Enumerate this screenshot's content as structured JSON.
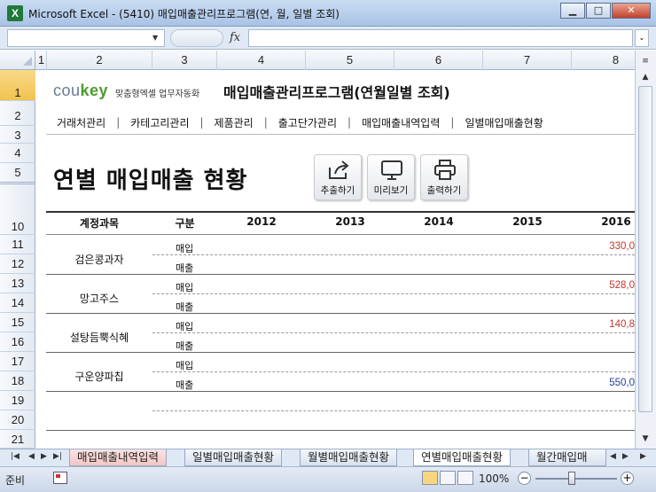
{
  "window": {
    "app_icon": "X",
    "title": "Microsoft Excel - (5410) 매입매출관리프로그램(연, 월, 일별 조회)",
    "minimize": "▁",
    "maximize": "□",
    "close": "✕"
  },
  "formula_bar": {
    "name_box": "",
    "fx": "fx",
    "formula": ""
  },
  "columns": [
    "1",
    "2",
    "3",
    "4",
    "5",
    "6",
    "7",
    "8"
  ],
  "rows": [
    "1",
    "2",
    "3",
    "4",
    "5",
    "10",
    "11",
    "12",
    "13",
    "14",
    "15",
    "16",
    "17",
    "18",
    "19",
    "20",
    "21"
  ],
  "sheet": {
    "logo": "coukey",
    "logo_sub": "맞춤형엑셀 업무자동화",
    "program_title": "매입매출관리프로그램(연월일별 조회)",
    "menu": [
      "거래처관리",
      "카테고리관리",
      "제품관리",
      "출고단가관리",
      "매입매출내역입력",
      "일별매입매출현황"
    ],
    "menu_sep": "|",
    "page_title": "연별 매입매출 현황",
    "buttons": {
      "export": "추출하기",
      "preview": "미리보기",
      "print": "출력하기"
    },
    "table": {
      "headers": [
        "계정과목",
        "구분",
        "2012",
        "2013",
        "2014",
        "2015",
        "2016"
      ],
      "accounts": [
        {
          "name": "검은콩과자",
          "purchase_label": "매입",
          "sales_label": "매출",
          "purchase_2016": "330,0",
          "sales_2016": ""
        },
        {
          "name": "망고주스",
          "purchase_label": "매입",
          "sales_label": "매출",
          "purchase_2016": "528,0",
          "sales_2016": ""
        },
        {
          "name": "설탕듬뿍식혜",
          "purchase_label": "매입",
          "sales_label": "매출",
          "purchase_2016": "140,8",
          "sales_2016": ""
        },
        {
          "name": "구운양파칩",
          "purchase_label": "매입",
          "sales_label": "매출",
          "purchase_2016": "",
          "sales_2016": "550,0"
        }
      ]
    }
  },
  "tabs": [
    "매입매출내역입력",
    "일별매입매출현황",
    "월별매입매출현황",
    "연별매입매출현황",
    "월간매입매"
  ],
  "active_tab": 3,
  "status": {
    "ready": "준비",
    "zoom": "100%",
    "minus": "−",
    "plus": "+"
  },
  "colors": {
    "purchase_value": "#c0392b",
    "sales_value": "#1f3f9a",
    "logo_key": "#4e9a2e"
  }
}
